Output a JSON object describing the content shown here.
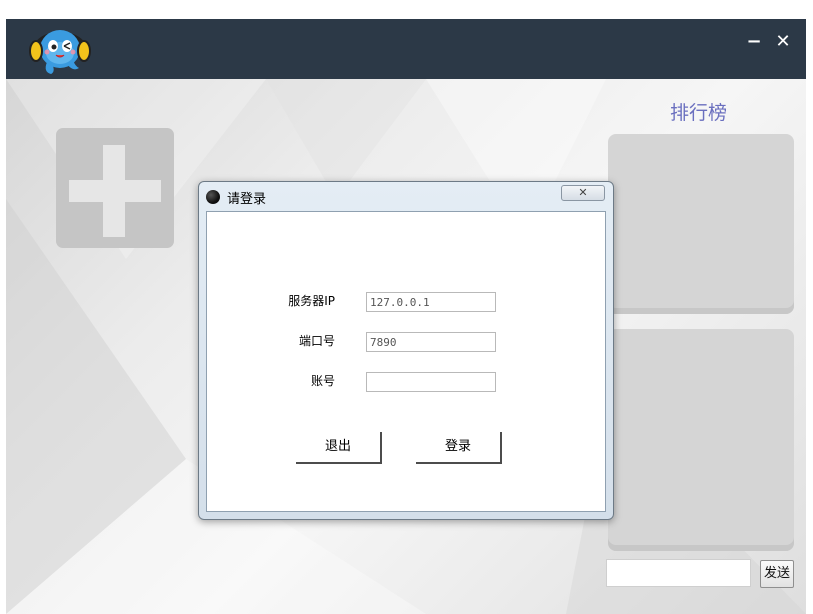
{
  "titlebar": {
    "minimize_glyph": "−",
    "close_glyph": "✕",
    "background_color": "#2c3947",
    "mascot_icon": "mascot-headphones-icon"
  },
  "main": {
    "ranking_title": "排行榜",
    "add_icon": "plus-icon",
    "accent_color": "#6a6fbf",
    "message_input": {
      "value": "",
      "placeholder": ""
    },
    "send_label": "发送"
  },
  "dialog": {
    "title": "请登录",
    "close_glyph": "✕",
    "fields": [
      {
        "label": "服务器IP",
        "value": "127.0.0.1"
      },
      {
        "label": "端口号",
        "value": "7890"
      },
      {
        "label": "账号",
        "value": ""
      }
    ],
    "exit_label": "退出",
    "login_label": "登录"
  }
}
